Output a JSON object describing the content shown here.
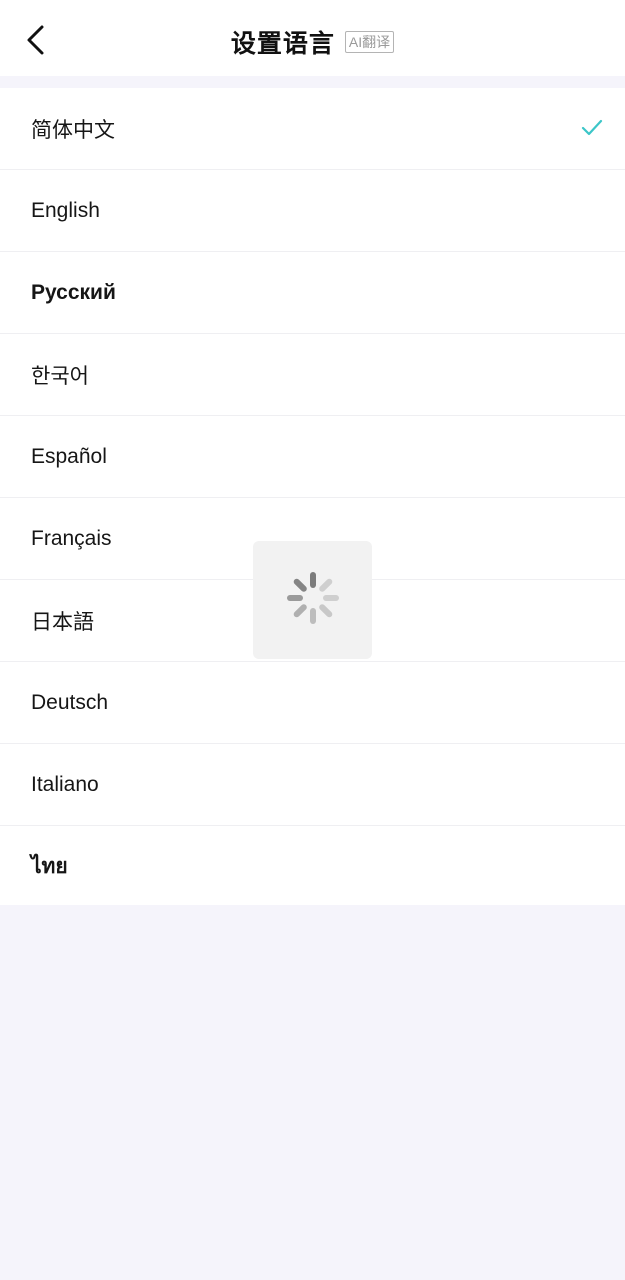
{
  "header": {
    "title": "设置语言",
    "ai_badge": "AI翻译",
    "back_icon": "chevron-left-icon"
  },
  "languages": [
    {
      "label": "简体中文",
      "selected": true
    },
    {
      "label": "English",
      "selected": false
    },
    {
      "label": "Русский",
      "selected": false
    },
    {
      "label": "한국어",
      "selected": false
    },
    {
      "label": "Español",
      "selected": false
    },
    {
      "label": "Français",
      "selected": false
    },
    {
      "label": "日本語",
      "selected": false
    },
    {
      "label": "Deutsch",
      "selected": false
    },
    {
      "label": "Italiano",
      "selected": false
    },
    {
      "label": "ไทย",
      "selected": false
    }
  ],
  "colors": {
    "accent": "#3cc6c8",
    "background": "#f5f4fb",
    "row_background": "#ffffff",
    "text": "#161616"
  },
  "loading_indicator": "spinner-icon"
}
